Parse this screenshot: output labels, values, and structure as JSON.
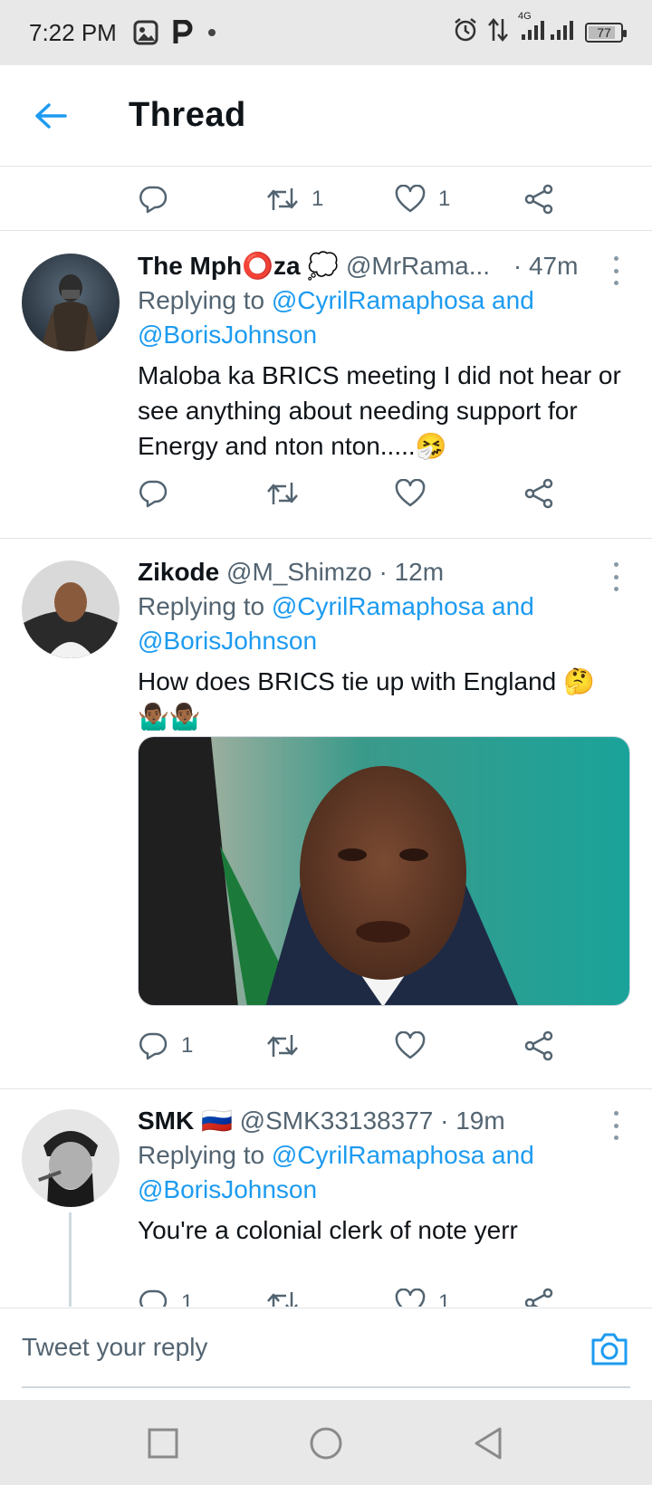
{
  "status_bar": {
    "time": "7:22 PM",
    "net_label": "4G",
    "battery": "77",
    "icons": [
      "gallery-icon",
      "parking-icon",
      "dot-icon",
      "alarm-icon",
      "data-arrows-icon",
      "signal-icon",
      "battery-icon"
    ]
  },
  "header": {
    "back_icon": "arrow-left-icon",
    "title": "Thread"
  },
  "prev_tweet_actions": {
    "reply_count": "",
    "retweet_count": "1",
    "like_count": "1"
  },
  "tweets": [
    {
      "name": "The Mph⭕za 💭",
      "handle": "@MrRama...",
      "time": "· 47m",
      "replying_prefix": "Replying to ",
      "replying_links": "@CyrilRamaphosa and @BorisJohnson",
      "text": "Maloba ka BRICS meeting I did not hear or see anything about needing support for Energy and nton nton.....🤧",
      "reply_count": "",
      "retweet_count": "",
      "like_count": ""
    },
    {
      "name": "Zikode",
      "handle": "@M_Shimzo",
      "time": "· 12m",
      "replying_prefix": "Replying to ",
      "replying_links": "@CyrilRamaphosa and @BorisJohnson",
      "text": "How does BRICS tie up with England 🤔 🤷🏾‍♂️🤷🏾‍♂️",
      "has_photo": true,
      "reply_count": "1",
      "retweet_count": "",
      "like_count": ""
    },
    {
      "name": "SMK 🇷🇺",
      "handle": "@SMK33138377",
      "time": "· 19m",
      "replying_prefix": "Replying to ",
      "replying_links": "@CyrilRamaphosa and @BorisJohnson",
      "text": "You're a colonial clerk of note yerr",
      "reply_count": "1",
      "retweet_count": "",
      "like_count": "1"
    }
  ],
  "reply_bar": {
    "placeholder": "Tweet your reply",
    "camera_icon": "camera-icon"
  },
  "nav_bar": {
    "icons": [
      "recents-square-icon",
      "home-circle-icon",
      "back-triangle-icon"
    ]
  },
  "colors": {
    "accent": "#1d9bf0",
    "text": "#0f1419",
    "secondary": "#536471",
    "divider": "#e1e4e8"
  }
}
